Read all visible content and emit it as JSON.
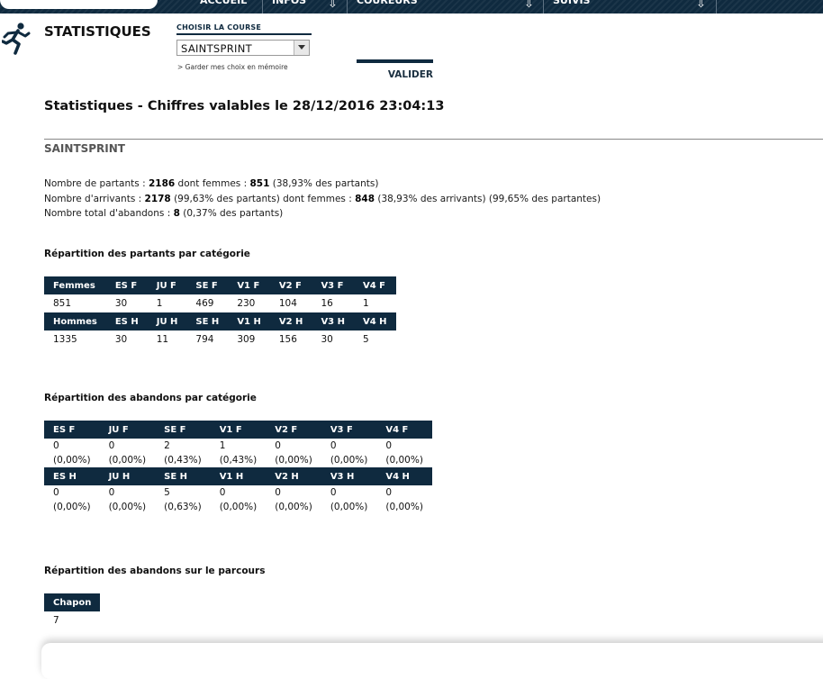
{
  "nav": {
    "items": [
      {
        "label": "ACCUEIL"
      },
      {
        "label": "INFOS"
      },
      {
        "label": "COUREURS"
      },
      {
        "label": "SUIVIS"
      }
    ]
  },
  "header": {
    "title": "STATISTIQUES",
    "course_label": "CHOISIR LA COURSE",
    "course_value": "SAINTSPRINT",
    "memo_link": "> Garder mes choix en mémoire",
    "validate_label": "VALIDER"
  },
  "main": {
    "heading": "Statistiques - Chiffres valables le 28/12/2016 23:04:13",
    "race_name": "SAINTSPRINT",
    "summary": {
      "line1_a": "Nombre de partants : ",
      "partants": "2186",
      "line1_b": "   dont femmes : ",
      "partants_femmes": "851",
      "line1_c": " (38,93% des partants)",
      "line2_a": "Nombre d'arrivants : ",
      "arrivants": "2178",
      "line2_b": " (99,63% des partants)   dont femmes : ",
      "arrivants_femmes": "848",
      "line2_c": " (38,93% des arrivants) (99,65% des partantes)",
      "line3_a": "Nombre total d'abandons : ",
      "abandons": "8",
      "line3_b": " (0,37% des partants)"
    },
    "partants_title": "Répartition des partants par catégorie",
    "partants_table": {
      "femmes_header": [
        "Femmes",
        "ES F",
        "JU F",
        "SE F",
        "V1 F",
        "V2 F",
        "V3 F",
        "V4 F"
      ],
      "femmes_values": [
        "851",
        "30",
        "1",
        "469",
        "230",
        "104",
        "16",
        "1"
      ],
      "hommes_header": [
        "Hommes",
        "ES H",
        "JU H",
        "SE H",
        "V1 H",
        "V2 H",
        "V3 H",
        "V4 H"
      ],
      "hommes_values": [
        "1335",
        "30",
        "11",
        "794",
        "309",
        "156",
        "30",
        "5"
      ]
    },
    "abandons_title": "Répartition des abandons par catégorie",
    "abandons_table": {
      "femmes_header": [
        "ES F",
        "JU F",
        "SE F",
        "V1 F",
        "V2 F",
        "V3 F",
        "V4 F"
      ],
      "femmes_values": [
        {
          "n": "0",
          "p": "(0,00%)"
        },
        {
          "n": "0",
          "p": "(0,00%)"
        },
        {
          "n": "2",
          "p": "(0,43%)"
        },
        {
          "n": "1",
          "p": "(0,43%)"
        },
        {
          "n": "0",
          "p": "(0,00%)"
        },
        {
          "n": "0",
          "p": "(0,00%)"
        },
        {
          "n": "0",
          "p": "(0,00%)"
        }
      ],
      "hommes_header": [
        "ES H",
        "JU H",
        "SE H",
        "V1 H",
        "V2 H",
        "V3 H",
        "V4 H"
      ],
      "hommes_values": [
        {
          "n": "0",
          "p": "(0,00%)"
        },
        {
          "n": "0",
          "p": "(0,00%)"
        },
        {
          "n": "5",
          "p": "(0,63%)"
        },
        {
          "n": "0",
          "p": "(0,00%)"
        },
        {
          "n": "0",
          "p": "(0,00%)"
        },
        {
          "n": "0",
          "p": "(0,00%)"
        },
        {
          "n": "0",
          "p": "(0,00%)"
        }
      ]
    },
    "parcours_title": "Répartition des abandons sur le parcours",
    "parcours_table": {
      "header": [
        "Chapon"
      ],
      "values": [
        "7"
      ]
    }
  },
  "colors": {
    "navy": "#0f2a3f",
    "text": "#1a1a1a",
    "muted": "#555555"
  }
}
